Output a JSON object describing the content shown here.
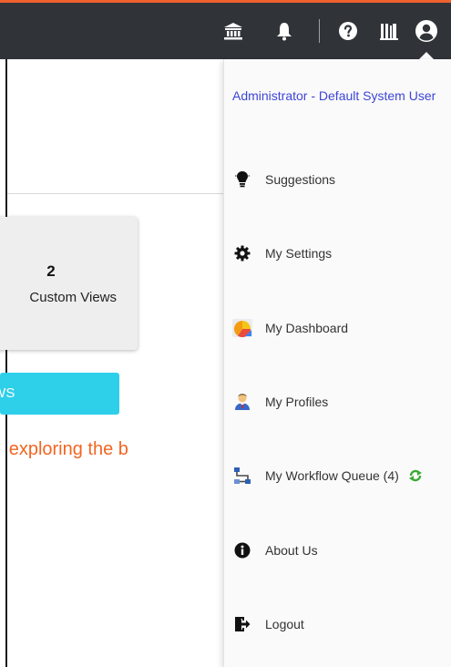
{
  "header": {
    "icons": [
      "bank-icon",
      "bell-icon",
      "help-icon",
      "library-icon",
      "user-circle-icon"
    ]
  },
  "main": {
    "card": {
      "count": "2",
      "label": "Custom Views"
    },
    "views_button": "Views",
    "explore_text": "Begin exploring the b"
  },
  "user_menu": {
    "user_name": "Administrator - Default System User",
    "items": [
      {
        "label": "Suggestions",
        "icon": "lightbulb-icon"
      },
      {
        "label": "My Settings",
        "icon": "gear-icon"
      },
      {
        "label": "My Dashboard",
        "icon": "dashboard-icon"
      },
      {
        "label": "My Profiles",
        "icon": "person-icon"
      },
      {
        "label": "My Workflow Queue (4)",
        "icon": "workflow-icon"
      },
      {
        "label": "About Us",
        "icon": "info-icon"
      },
      {
        "label": "Logout",
        "icon": "logout-icon"
      }
    ]
  },
  "colors": {
    "topbar": "#303438",
    "accent_orange": "#f26522",
    "button_cyan": "#2ecfe9",
    "link_blue": "#3d45d8"
  }
}
